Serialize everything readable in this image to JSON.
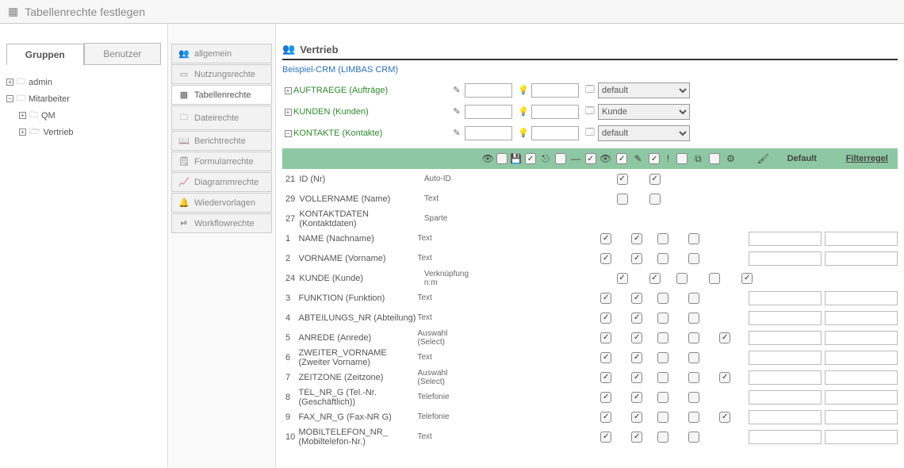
{
  "page": {
    "title": "Tabellenrechte festlegen"
  },
  "left": {
    "tabs": {
      "groups": "Gruppen",
      "users": "Benutzer",
      "active": "groups"
    },
    "tree": [
      {
        "expand": "+",
        "label": "admin",
        "indent": 0,
        "open": false
      },
      {
        "expand": "−",
        "label": "Mitarbeiter",
        "indent": 0,
        "open": false
      },
      {
        "expand": "+",
        "label": "QM",
        "indent": 1,
        "open": false
      },
      {
        "expand": "+",
        "label": "Vertrieb",
        "indent": 1,
        "open": true
      }
    ]
  },
  "nav": {
    "items": [
      {
        "id": "allgemein",
        "label": "allgemein",
        "icon": "👥"
      },
      {
        "id": "nutzungsrechte",
        "label": "Nutzungsrechte",
        "icon": "▭"
      },
      {
        "id": "tabellenrechte",
        "label": "Tabellenrechte",
        "icon": "▦"
      },
      {
        "id": "dateirechte",
        "label": "Dateirechte",
        "icon": "🗀"
      },
      {
        "id": "berichtrechte",
        "label": "Berichtrechte",
        "icon": "📖"
      },
      {
        "id": "formularrechte",
        "label": "Formularrechte",
        "icon": "🗒"
      },
      {
        "id": "diagrammrechte",
        "label": "Diagrammrechte",
        "icon": "📈"
      },
      {
        "id": "wiedervorlagen",
        "label": "Wiedervorlagen",
        "icon": "🔔"
      },
      {
        "id": "workflowrechte",
        "label": "Workflowrechte",
        "icon": "⏯"
      }
    ],
    "active": "tabellenrechte"
  },
  "main": {
    "title": "Vertrieb",
    "breadcrumb": "Beispiel-CRM (LIMBAS CRM)",
    "tables": [
      {
        "expand": "+",
        "name": "AUFTRAEGE (Aufträge)",
        "select": "default"
      },
      {
        "expand": "+",
        "name": "KUNDEN (Kunden)",
        "select": "Kunde"
      },
      {
        "expand": "−",
        "name": "KONTAKTE (Kontakte)",
        "select": "default"
      }
    ],
    "header_labels": {
      "default": "Default",
      "filter": "Filterregel"
    },
    "fields": [
      {
        "id": "21",
        "name": "ID (Nr)",
        "type": "Auto-ID",
        "c1": true,
        "c2": true,
        "c3": null,
        "c4": null,
        "c5": null,
        "inputs": false
      },
      {
        "id": "29",
        "name": "VOLLERNAME (Name)",
        "type": "Text",
        "c1": false,
        "c2": false,
        "c3": null,
        "c4": null,
        "c5": null,
        "inputs": false
      },
      {
        "id": "27",
        "name": "KONTAKTDATEN (Kontaktdaten)",
        "type": "Sparte",
        "c1": null,
        "c2": null,
        "c3": null,
        "c4": null,
        "c5": null,
        "inputs": false
      },
      {
        "id": "1",
        "name": "NAME (Nachname)",
        "type": "Text",
        "c1": true,
        "c2": true,
        "c3": false,
        "c4": false,
        "c5": null,
        "inputs": true
      },
      {
        "id": "2",
        "name": "VORNAME (Vorname)",
        "type": "Text",
        "c1": true,
        "c2": true,
        "c3": false,
        "c4": false,
        "c5": null,
        "inputs": true
      },
      {
        "id": "24",
        "name": "KUNDE (Kunde)",
        "type": "Verknüpfung n:m",
        "c1": true,
        "c2": true,
        "c3": false,
        "c4": false,
        "c5": true,
        "inputs": false
      },
      {
        "id": "3",
        "name": "FUNKTION (Funktion)",
        "type": "Text",
        "c1": true,
        "c2": true,
        "c3": false,
        "c4": false,
        "c5": null,
        "inputs": true
      },
      {
        "id": "4",
        "name": "ABTEILUNGS_NR (Abteilung)",
        "type": "Text",
        "c1": true,
        "c2": true,
        "c3": false,
        "c4": false,
        "c5": null,
        "inputs": true
      },
      {
        "id": "5",
        "name": "ANREDE (Anrede)",
        "type": "Auswahl (Select)",
        "c1": true,
        "c2": true,
        "c3": false,
        "c4": false,
        "c5": true,
        "inputs": true
      },
      {
        "id": "6",
        "name": "ZWEITER_VORNAME (Zweiter Vorname)",
        "type": "Text",
        "c1": true,
        "c2": true,
        "c3": false,
        "c4": false,
        "c5": null,
        "inputs": true
      },
      {
        "id": "7",
        "name": "ZEITZONE (Zeitzone)",
        "type": "Auswahl (Select)",
        "c1": true,
        "c2": true,
        "c3": false,
        "c4": false,
        "c5": true,
        "inputs": true
      },
      {
        "id": "8",
        "name": "TEL_NR_G (Tel.-Nr. (Geschäftlich))",
        "type": "Telefonie",
        "c1": true,
        "c2": true,
        "c3": false,
        "c4": false,
        "c5": null,
        "inputs": true
      },
      {
        "id": "9",
        "name": "FAX_NR_G (Fax-NR G)",
        "type": "Telefonie",
        "c1": true,
        "c2": true,
        "c3": false,
        "c4": false,
        "c5": true,
        "inputs": true
      },
      {
        "id": "10",
        "name": "MOBILTELEFON_NR_ (Mobiltelefon-Nr.)",
        "type": "Text",
        "c1": true,
        "c2": true,
        "c3": false,
        "c4": false,
        "c5": null,
        "inputs": true
      }
    ]
  }
}
